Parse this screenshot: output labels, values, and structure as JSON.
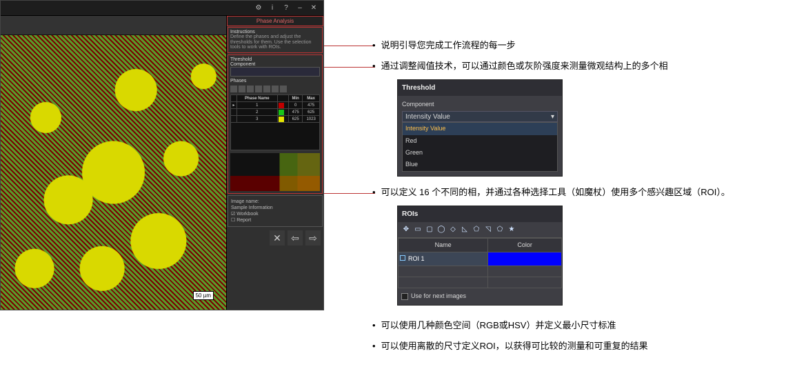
{
  "app": {
    "title": "Phase Analysis",
    "toolbar_icons": [
      "gear-icon",
      "info-icon",
      "help-icon",
      "minimize-icon",
      "close-icon"
    ],
    "scalebar": "50 µm",
    "instructions_header": "Instructions",
    "instructions_text": "Define the phases and adjust the thresholds for them. Use the selection tools to work with ROIs.",
    "threshold_header": "Threshold",
    "component_label": "Component",
    "component_value": "Intensity Value",
    "phase_header": "Phases",
    "phase_columns": [
      "",
      "Phase Name",
      "",
      "Min",
      "Max"
    ],
    "phases": [
      {
        "name": "1",
        "color": "#c00000",
        "min": "0",
        "max": "475"
      },
      {
        "name": "2",
        "color": "#19c619",
        "min": "475",
        "max": "625"
      },
      {
        "name": "3",
        "color": "#e6e600",
        "min": "625",
        "max": "1023"
      }
    ],
    "info_lines": [
      "Image name:",
      "Sample Information",
      "",
      "☑ Workbook",
      "☐ Report"
    ],
    "nav_icons": [
      "✕",
      "⇦",
      "⇨"
    ]
  },
  "threshold_panel": {
    "title": "Threshold",
    "label": "Component",
    "selected": "Intensity Value",
    "options": [
      "Intensity Value",
      "Red",
      "Green",
      "Blue"
    ]
  },
  "rois_panel": {
    "title": "ROIs",
    "tool_icons": [
      "pointer",
      "rect",
      "roundrect",
      "circle",
      "diamond",
      "triangle-l",
      "poly",
      "triangle-r",
      "pentagon",
      "star"
    ],
    "columns": [
      "Name",
      "Color"
    ],
    "rows": [
      {
        "name": "ROI 1",
        "color": "#0000ff"
      }
    ],
    "footer_label": "Use for next images"
  },
  "notes": {
    "n1": "说明引导您完成工作流程的每一步",
    "n2": "通过调整阈值技术，可以通过颜色或灰阶强度来测量微观结构上的多个相",
    "n3": "可以定义 16 个不同的相，并通过各种选择工具（如魔杖）使用多个感兴趣区域（ROI）。",
    "n4": "可以使用几种颜色空间（RGB或HSV）并定义最小尺寸标准",
    "n5": "可以使用离散的尺寸定义ROI，以获得可比较的测量和可重复的结果"
  }
}
